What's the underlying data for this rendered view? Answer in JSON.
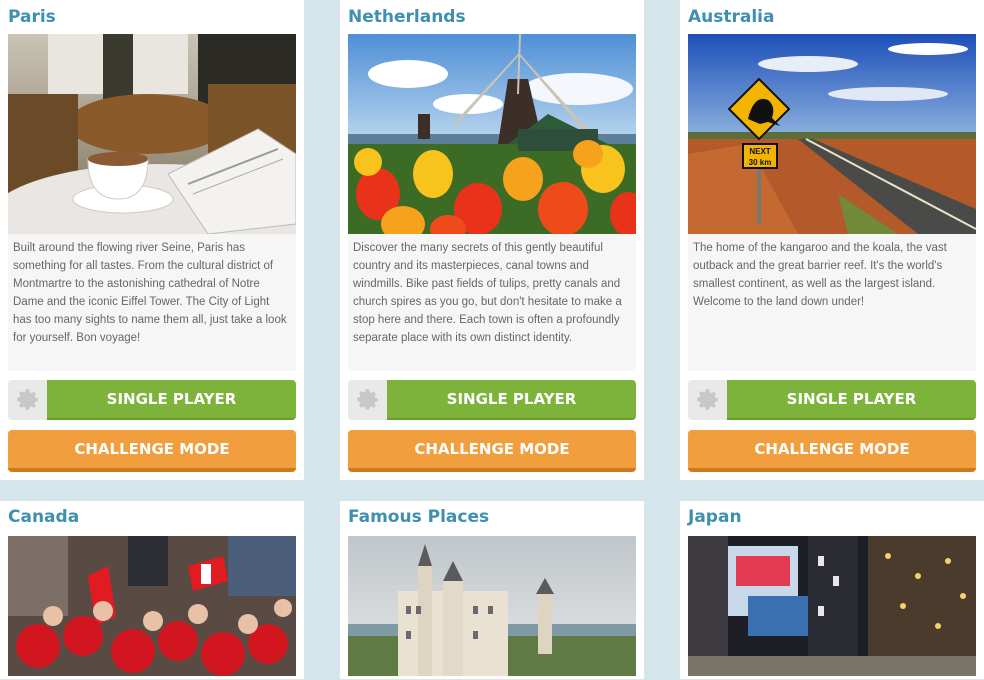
{
  "cards": [
    {
      "title": "Paris",
      "image": "paris-cafe-photo",
      "description": "Built around the flowing river Seine, Paris has something for all tastes. From the cultural district of Montmartre to the astonishing cathedral of Notre Dame and the iconic Eiffel Tower. The City of Light has too many sights to name them all, just take a look for yourself. Bon voyage!",
      "single_label": "SINGLE PLAYER",
      "challenge_label": "CHALLENGE MODE"
    },
    {
      "title": "Netherlands",
      "image": "windmill-tulips-photo",
      "description": "Discover the many secrets of this gently beautiful country and its masterpieces, canal towns and windmills. Bike past fields of tulips, pretty canals and church spires as you go, but don't hesitate to make a stop here and there. Each town is often a profoundly separate place with its own distinct identity.",
      "single_label": "SINGLE PLAYER",
      "challenge_label": "CHALLENGE MODE"
    },
    {
      "title": "Australia",
      "image": "outback-road-photo",
      "description": "The home of the kangaroo and the koala, the vast outback and the great barrier reef. It's the world's smallest continent, as well as the largest island. Welcome to the land down under!",
      "single_label": "SINGLE PLAYER",
      "challenge_label": "CHALLENGE MODE",
      "sign_text": [
        "NEXT",
        "30 km"
      ]
    },
    {
      "title": "Canada",
      "image": "canada-crowd-photo"
    },
    {
      "title": "Famous Places",
      "image": "castle-photo"
    },
    {
      "title": "Japan",
      "image": "tokyo-street-photo"
    }
  ],
  "icons": {
    "settings": "gear-icon"
  },
  "colors": {
    "title": "#3f8fb0",
    "single_player": "#7db33a",
    "challenge_mode": "#f19e3f",
    "background": "#d4e6ec"
  }
}
